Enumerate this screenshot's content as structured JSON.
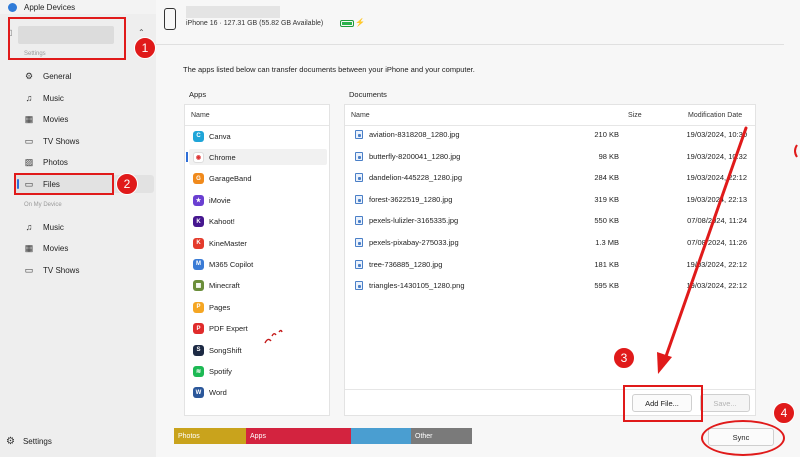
{
  "window": {
    "title": "Apple Devices",
    "controls": [
      "—",
      "☐",
      "✕"
    ]
  },
  "sidebar": {
    "section_settings": "Settings",
    "settings_items": [
      {
        "label": "General",
        "icon": "gear-icon",
        "glyph": "⚙"
      },
      {
        "label": "Music",
        "icon": "music-note-icon",
        "glyph": "♫"
      },
      {
        "label": "Movies",
        "icon": "film-icon",
        "glyph": "▦"
      },
      {
        "label": "TV Shows",
        "icon": "tv-icon",
        "glyph": "▭"
      },
      {
        "label": "Photos",
        "icon": "photo-icon",
        "glyph": "▨"
      },
      {
        "label": "Files",
        "icon": "folder-icon",
        "glyph": "▭",
        "active": true
      }
    ],
    "section_on_my_device": "On My Device",
    "device_items": [
      {
        "label": "Music",
        "icon": "music-note-icon",
        "glyph": "♫"
      },
      {
        "label": "Movies",
        "icon": "film-icon",
        "glyph": "▦"
      },
      {
        "label": "TV Shows",
        "icon": "tv-icon",
        "glyph": "▭"
      }
    ],
    "bottom_settings": "Settings"
  },
  "device": {
    "info": "iPhone 16 · 127.31 GB (55.82 GB Available)"
  },
  "main": {
    "intro": "The apps listed below can transfer documents between your iPhone and your computer.",
    "apps_title": "Apps",
    "documents_title": "Documents",
    "apps_header": "Name",
    "apps": [
      {
        "name": "Canva",
        "color": "#1fa5d8",
        "glyph": "C"
      },
      {
        "name": "Chrome",
        "color": "#ffffff",
        "glyph": "◉",
        "selected": true
      },
      {
        "name": "GarageBand",
        "color": "#f08a1c",
        "glyph": "G"
      },
      {
        "name": "iMovie",
        "color": "#6a3fd1",
        "glyph": "★"
      },
      {
        "name": "Kahoot!",
        "color": "#46178f",
        "glyph": "K"
      },
      {
        "name": "KineMaster",
        "color": "#e43b2c",
        "glyph": "K"
      },
      {
        "name": "M365 Copilot",
        "color": "#3a7bd5",
        "glyph": "M"
      },
      {
        "name": "Minecraft",
        "color": "#6b8e3a",
        "glyph": "▦"
      },
      {
        "name": "Pages",
        "color": "#f5a623",
        "glyph": "P"
      },
      {
        "name": "PDF Expert",
        "color": "#e02b2b",
        "glyph": "P"
      },
      {
        "name": "SongShift",
        "color": "#1d2a44",
        "glyph": "S"
      },
      {
        "name": "Spotify",
        "color": "#1db954",
        "glyph": "≋"
      },
      {
        "name": "Word",
        "color": "#2b579a",
        "glyph": "W"
      }
    ],
    "docs_headers": {
      "name": "Name",
      "size": "Size",
      "date": "Modification Date"
    },
    "documents": [
      {
        "name": "aviation-8318208_1280.jpg",
        "size": "210 KB",
        "date": "19/03/2024, 10:30"
      },
      {
        "name": "butterfly-8200041_1280.jpg",
        "size": "98 KB",
        "date": "19/03/2024, 10:32"
      },
      {
        "name": "dandelion-445228_1280.jpg",
        "size": "284 KB",
        "date": "19/03/2024, 22:12"
      },
      {
        "name": "forest-3622519_1280.jpg",
        "size": "319 KB",
        "date": "19/03/2024, 22:13"
      },
      {
        "name": "pexels-lulizler-3165335.jpg",
        "size": "550 KB",
        "date": "07/08/2024, 11:24"
      },
      {
        "name": "pexels-pixabay-275033.jpg",
        "size": "1.3 MB",
        "date": "07/08/2024, 11:26"
      },
      {
        "name": "tree-736885_1280.jpg",
        "size": "181 KB",
        "date": "19/03/2024, 22:12"
      },
      {
        "name": "triangles-1430105_1280.png",
        "size": "595 KB",
        "date": "19/03/2024, 22:12"
      }
    ],
    "add_file": "Add File...",
    "save": "Save..."
  },
  "storage": [
    {
      "label": "Photos",
      "color": "#c9a31c"
    },
    {
      "label": "Apps",
      "color": "#d3233f"
    },
    {
      "label": "",
      "color": "#4a9ed1"
    },
    {
      "label": "Other",
      "color": "#7a7a7a"
    }
  ],
  "sync": "Sync",
  "annotations": {
    "badges": [
      "1",
      "2",
      "3",
      "4"
    ],
    "color": "#e01a1a"
  }
}
